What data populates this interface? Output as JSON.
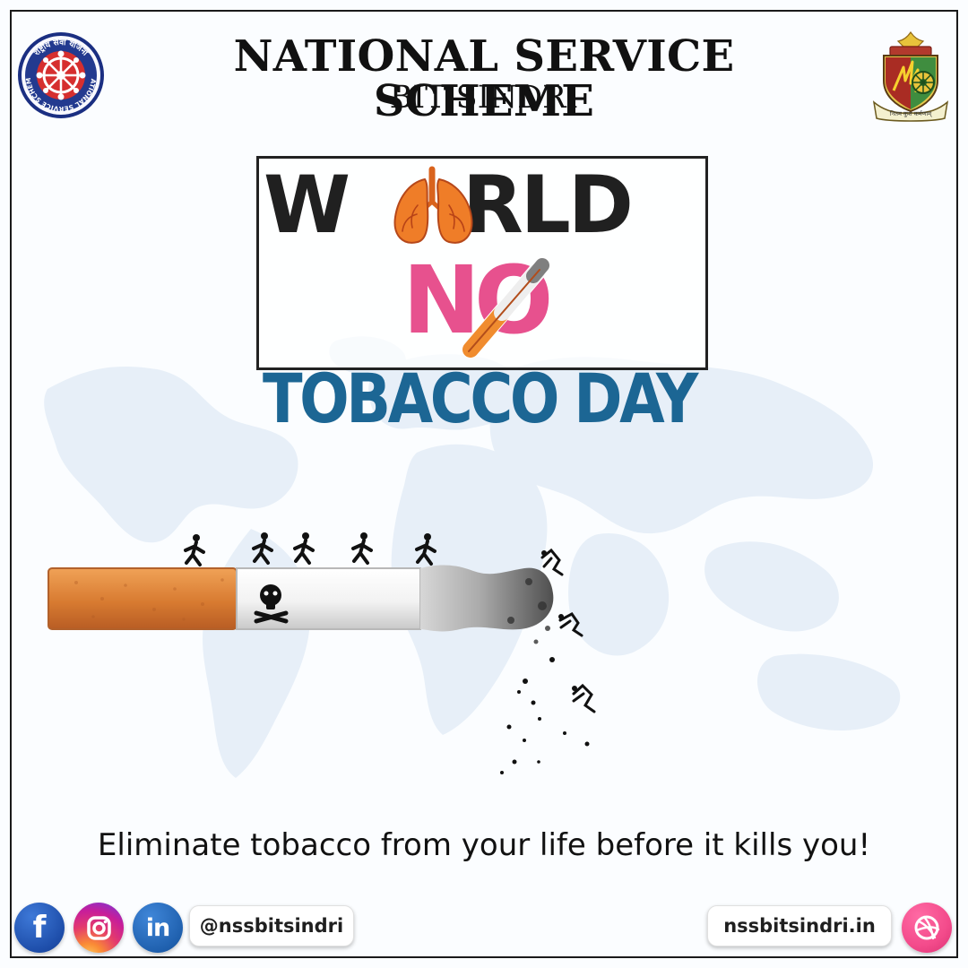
{
  "header": {
    "title": "NATIONAL SERVICE SCHEME",
    "subtitle": "BIT SINDRI"
  },
  "logos": {
    "nss": {
      "icon": "nss-emblem",
      "top_text": "राष्ट्रीय सेवा योजना",
      "bottom_text": "NATIONAL SERVICE SCHEME",
      "colors": {
        "outer": "#233a8f",
        "inner": "#d62f2f",
        "wheel": "#ffffff"
      }
    },
    "college": {
      "icon": "college-crest",
      "motto": "नितम कुश कर्मणाम्",
      "colors": {
        "shield_red": "#a92c23",
        "shield_green": "#3f8d3f",
        "gold": "#e8c33b"
      }
    }
  },
  "campaign": {
    "word_world_first": "W",
    "word_world_rest": "RLD",
    "word_no": "NO",
    "word_tobacco_day": "TOBACCO DAY",
    "colors": {
      "world": "#202020",
      "no": "#e7518e",
      "tobacco_day": "#1c6694",
      "lungs": "#ef7d28"
    }
  },
  "illustration": {
    "background": "world-map",
    "main_object": "burning-cigarette",
    "warning_symbol": "skull-and-crossbones",
    "runner_count": 5
  },
  "message": {
    "tagline": "Eliminate tobacco from your life before it kills you!"
  },
  "social": {
    "facebook_icon": "facebook-icon",
    "instagram_icon": "instagram-icon",
    "linkedin_icon": "linkedin-icon",
    "handle": "@nssbitsindri",
    "website": "nssbitsindri.in",
    "dribbble_icon": "dribbble-icon"
  },
  "theme": {
    "border": "#1a1a1a",
    "text": "#111111",
    "facebook": "#1e4eaa",
    "linkedin": "#1f60ae",
    "dribbble": "#f34b8b"
  }
}
